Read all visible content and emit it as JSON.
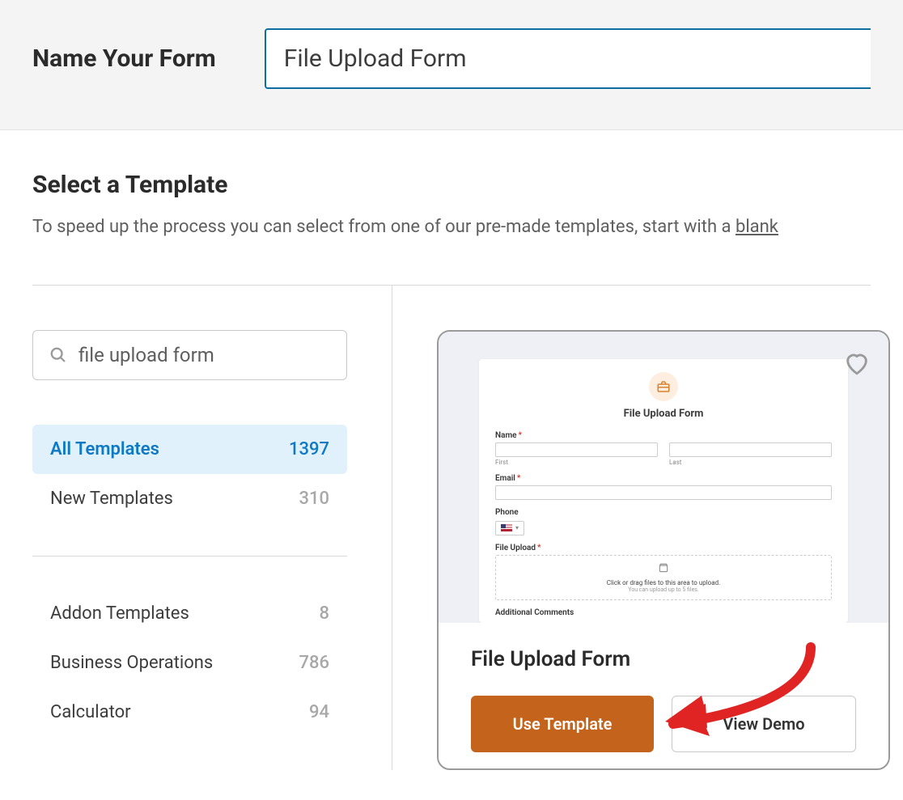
{
  "header": {
    "label": "Name Your Form",
    "form_name": "File Upload Form"
  },
  "section": {
    "title": "Select a Template",
    "subtitle_prefix": "To speed up the process you can select from one of our pre-made templates, start with a ",
    "blank_link": "blank"
  },
  "sidebar": {
    "search_value": "file upload form",
    "categories_primary": [
      {
        "label": "All Templates",
        "count": 1397
      },
      {
        "label": "New Templates",
        "count": 310
      }
    ],
    "categories_secondary": [
      {
        "label": "Addon Templates",
        "count": 8
      },
      {
        "label": "Business Operations",
        "count": 786
      },
      {
        "label": "Calculator",
        "count": 94
      }
    ]
  },
  "preview": {
    "form_title": "File Upload Form",
    "fields": {
      "name": "Name",
      "first": "First",
      "last": "Last",
      "email": "Email",
      "phone": "Phone",
      "upload": "File Upload",
      "upload_line1": "Click or drag files to this area to upload.",
      "upload_line2": "You can upload up to 5 files.",
      "additional": "Additional Comments"
    }
  },
  "card": {
    "title": "File Upload Form",
    "use_template": "Use Template",
    "view_demo": "View Demo"
  }
}
